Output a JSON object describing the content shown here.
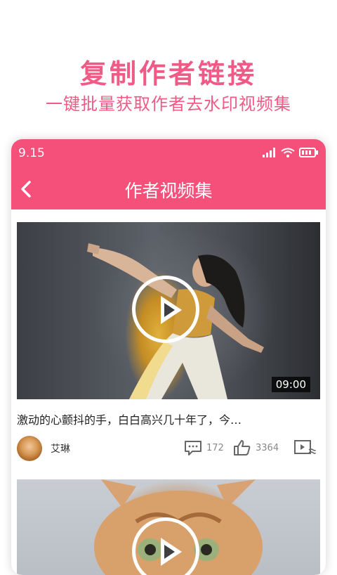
{
  "promo": {
    "title": "复制作者链接",
    "subtitle": "一键批量获取作者去水印视频集"
  },
  "status_bar": {
    "time": "9.15",
    "icons": [
      "signal-icon",
      "wifi-icon",
      "battery-icon"
    ]
  },
  "app_bar": {
    "title": "作者视频集",
    "back_icon": "chevron-left-icon"
  },
  "videos": [
    {
      "duration": "09:00",
      "caption": "激动的心颤抖的手，白白高兴几十年了，今…",
      "author": "艾琳",
      "comments": "172",
      "likes": "3364"
    },
    {
      "duration": "",
      "caption": "",
      "author": "",
      "comments": "",
      "likes": ""
    }
  ],
  "colors": {
    "accent": "#f5507a",
    "promo_text": "#f05a86"
  }
}
